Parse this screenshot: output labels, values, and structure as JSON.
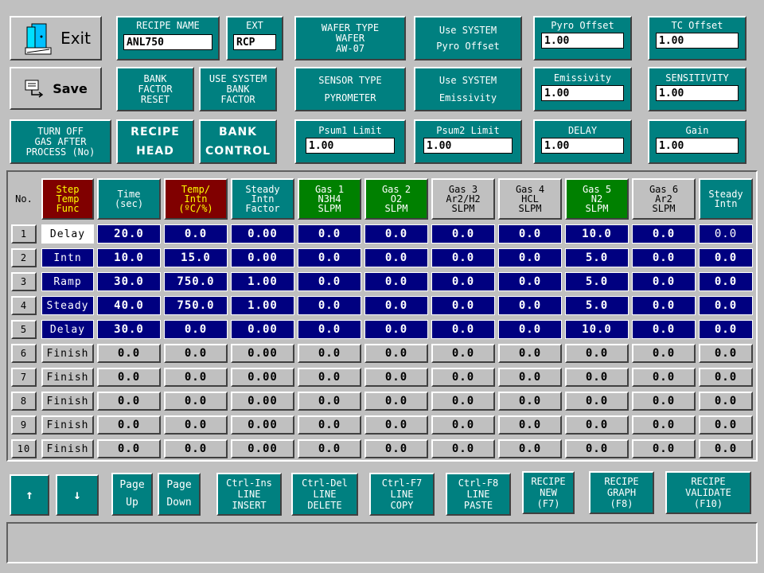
{
  "toolbar": {
    "exit_label": "Exit",
    "save_label": "Save"
  },
  "header_row1": {
    "recipe_name": {
      "label": "RECIPE NAME",
      "value": "ANL750"
    },
    "ext": {
      "label": "EXT",
      "value": "RCP"
    },
    "wafer_type": {
      "label": "WAFER TYPE\nWAFER\nAW-07"
    },
    "use_system_pyro": {
      "label": "Use SYSTEM\nPyro Offset"
    },
    "pyro_offset": {
      "label": "Pyro Offset",
      "value": "1.00"
    },
    "tc_offset": {
      "label": "TC Offset",
      "value": "1.00"
    }
  },
  "header_row2": {
    "bank_factor_reset": {
      "label": "BANK\nFACTOR\nRESET"
    },
    "use_system_bank": {
      "label": "USE SYSTEM\nBANK\nFACTOR"
    },
    "sensor_type": {
      "label": "SENSOR TYPE\nPYROMETER"
    },
    "use_system_emis": {
      "label": "Use SYSTEM\nEmissivity"
    },
    "emissivity": {
      "label": "Emissivity",
      "value": "1.00"
    },
    "sensitivity": {
      "label": "SENSITIVITY",
      "value": "1.00"
    }
  },
  "header_row3": {
    "turn_off_gas": {
      "label": "TURN OFF\nGAS AFTER\nPROCESS (No)"
    },
    "recipe_head": {
      "label": "RECIPE\nHEAD"
    },
    "bank_control": {
      "label": "BANK\nCONTROL"
    },
    "psum1": {
      "label": "Psum1 Limit",
      "value": "1.00"
    },
    "psum2": {
      "label": "Psum2 Limit",
      "value": "1.00"
    },
    "delay": {
      "label": "DELAY",
      "value": "1.00"
    },
    "gain": {
      "label": "Gain",
      "value": "1.00"
    }
  },
  "table": {
    "columns": [
      {
        "label": "No.",
        "bg": "#c0c0c0",
        "fg": "#000000"
      },
      {
        "label": "Step\nTemp\nFunc",
        "bg": "#800000",
        "fg": "#ffff00"
      },
      {
        "label": "Time\n(sec)",
        "bg": "#008080",
        "fg": "#ffffff"
      },
      {
        "label": "Temp/\nIntn\n(ºC/%)",
        "bg": "#800000",
        "fg": "#ffff00"
      },
      {
        "label": "Steady\nIntn\nFactor",
        "bg": "#008080",
        "fg": "#ffffff"
      },
      {
        "label": "Gas 1\nN3H4\nSLPM",
        "bg": "#008000",
        "fg": "#ffffff"
      },
      {
        "label": "Gas 2\nO2\nSLPM",
        "bg": "#008000",
        "fg": "#ffffff"
      },
      {
        "label": "Gas 3\nAr2/H2\nSLPM",
        "bg": "#c0c0c0",
        "fg": "#000000"
      },
      {
        "label": "Gas 4\nHCL\nSLPM",
        "bg": "#c0c0c0",
        "fg": "#000000"
      },
      {
        "label": "Gas 5\nN2\nSLPM",
        "bg": "#008000",
        "fg": "#ffffff"
      },
      {
        "label": "Gas 6\nAr2\nSLPM",
        "bg": "#c0c0c0",
        "fg": "#000000"
      },
      {
        "label": "Steady\nIntn",
        "bg": "#008080",
        "fg": "#ffffff"
      }
    ],
    "rows": [
      {
        "no": "1",
        "step": "Delay",
        "style": "blue",
        "step_style": "white",
        "values": [
          "20.0",
          "0.0",
          "0.00",
          "0.0",
          "0.0",
          "0.0",
          "0.0",
          "10.0",
          "0.0",
          "0.0"
        ]
      },
      {
        "no": "2",
        "step": "Intn",
        "style": "blue",
        "step_style": "blue",
        "values": [
          "10.0",
          "15.0",
          "0.00",
          "0.0",
          "0.0",
          "0.0",
          "0.0",
          "5.0",
          "0.0",
          "0.0"
        ]
      },
      {
        "no": "3",
        "step": "Ramp",
        "style": "blue",
        "step_style": "blue",
        "values": [
          "30.0",
          "750.0",
          "1.00",
          "0.0",
          "0.0",
          "0.0",
          "0.0",
          "5.0",
          "0.0",
          "0.0"
        ]
      },
      {
        "no": "4",
        "step": "Steady",
        "style": "blue",
        "step_style": "blue",
        "values": [
          "40.0",
          "750.0",
          "1.00",
          "0.0",
          "0.0",
          "0.0",
          "0.0",
          "5.0",
          "0.0",
          "0.0"
        ]
      },
      {
        "no": "5",
        "step": "Delay",
        "style": "blue",
        "step_style": "blue",
        "values": [
          "30.0",
          "0.0",
          "0.00",
          "0.0",
          "0.0",
          "0.0",
          "0.0",
          "10.0",
          "0.0",
          "0.0"
        ]
      },
      {
        "no": "6",
        "step": "Finish",
        "style": "grey",
        "step_style": "grey",
        "values": [
          "0.0",
          "0.0",
          "0.00",
          "0.0",
          "0.0",
          "0.0",
          "0.0",
          "0.0",
          "0.0",
          "0.0"
        ]
      },
      {
        "no": "7",
        "step": "Finish",
        "style": "grey",
        "step_style": "grey",
        "values": [
          "0.0",
          "0.0",
          "0.00",
          "0.0",
          "0.0",
          "0.0",
          "0.0",
          "0.0",
          "0.0",
          "0.0"
        ]
      },
      {
        "no": "8",
        "step": "Finish",
        "style": "grey",
        "step_style": "grey",
        "values": [
          "0.0",
          "0.0",
          "0.00",
          "0.0",
          "0.0",
          "0.0",
          "0.0",
          "0.0",
          "0.0",
          "0.0"
        ]
      },
      {
        "no": "9",
        "step": "Finish",
        "style": "grey",
        "step_style": "grey",
        "values": [
          "0.0",
          "0.0",
          "0.00",
          "0.0",
          "0.0",
          "0.0",
          "0.0",
          "0.0",
          "0.0",
          "0.0"
        ]
      },
      {
        "no": "10",
        "step": "Finish",
        "style": "grey",
        "step_style": "grey",
        "values": [
          "0.0",
          "0.0",
          "0.00",
          "0.0",
          "0.0",
          "0.0",
          "0.0",
          "0.0",
          "0.0",
          "0.0"
        ]
      }
    ]
  },
  "bottom_buttons": {
    "up": "↑",
    "down": "↓",
    "page_up": "Page\nUp",
    "page_down": "Page\nDown",
    "line_insert": "Ctrl-Ins\nLINE\nINSERT",
    "line_delete": "Ctrl-Del\nLINE\nDELETE",
    "line_copy": "Ctrl-F7\nLINE\nCOPY",
    "line_paste": "Ctrl-F8\nLINE\nPASTE",
    "recipe_new": "RECIPE\nNEW\n(F7)",
    "recipe_graph": "RECIPE\nGRAPH\n(F8)",
    "recipe_validate": "RECIPE\nVALIDATE\n(F10)"
  },
  "status": {
    "text": ""
  }
}
